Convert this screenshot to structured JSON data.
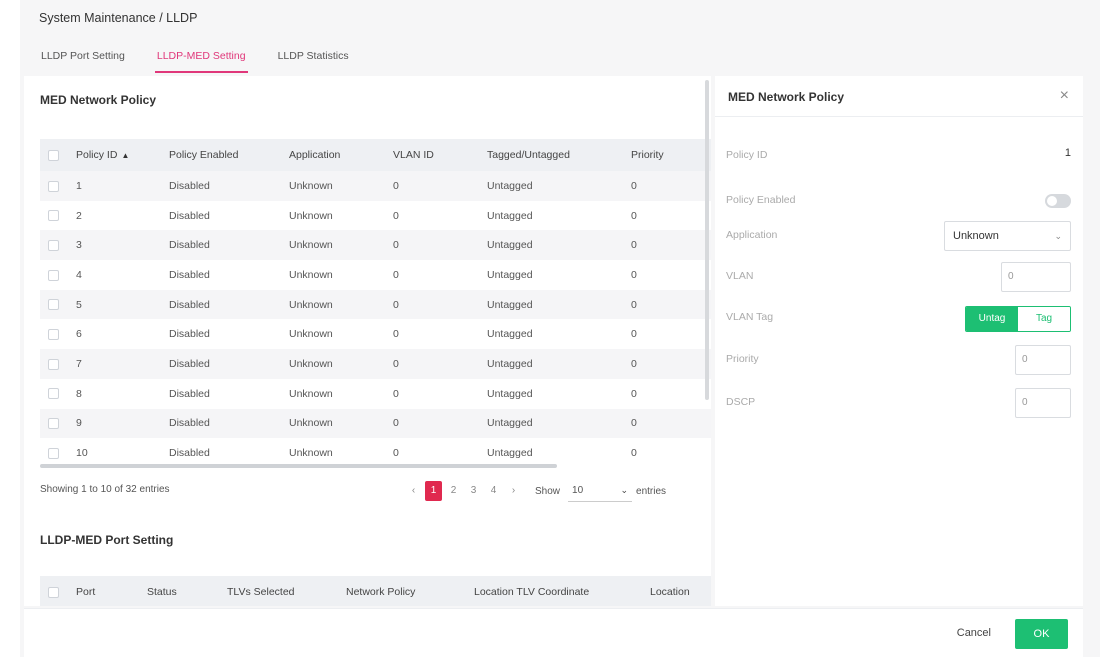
{
  "breadcrumb": "System Maintenance / LLDP",
  "tabs": [
    {
      "label": "LLDP Port Setting"
    },
    {
      "label": "LLDP-MED Setting"
    },
    {
      "label": "LLDP Statistics"
    }
  ],
  "policy_section": {
    "title": "MED Network Policy",
    "columns": [
      "Policy ID",
      "Policy Enabled",
      "Application",
      "VLAN ID",
      "Tagged/Untagged",
      "Priority"
    ],
    "rows": [
      [
        "1",
        "Disabled",
        "Unknown",
        "0",
        "Untagged",
        "0"
      ],
      [
        "2",
        "Disabled",
        "Unknown",
        "0",
        "Untagged",
        "0"
      ],
      [
        "3",
        "Disabled",
        "Unknown",
        "0",
        "Untagged",
        "0"
      ],
      [
        "4",
        "Disabled",
        "Unknown",
        "0",
        "Untagged",
        "0"
      ],
      [
        "5",
        "Disabled",
        "Unknown",
        "0",
        "Untagged",
        "0"
      ],
      [
        "6",
        "Disabled",
        "Unknown",
        "0",
        "Untagged",
        "0"
      ],
      [
        "7",
        "Disabled",
        "Unknown",
        "0",
        "Untagged",
        "0"
      ],
      [
        "8",
        "Disabled",
        "Unknown",
        "0",
        "Untagged",
        "0"
      ],
      [
        "9",
        "Disabled",
        "Unknown",
        "0",
        "Untagged",
        "0"
      ],
      [
        "10",
        "Disabled",
        "Unknown",
        "0",
        "Untagged",
        "0"
      ]
    ],
    "showing_text": "Showing 1 to 10 of 32 entries",
    "pages": [
      "1",
      "2",
      "3",
      "4"
    ],
    "prev": "‹",
    "next": "›",
    "show_label": "Show",
    "entries_value": "10",
    "entries_label": "entries"
  },
  "port_section": {
    "title": "LLDP-MED Port Setting",
    "columns": [
      "Port",
      "Status",
      "TLVs Selected",
      "Network Policy",
      "Location TLV Coordinate",
      "Location"
    ]
  },
  "side_panel": {
    "title": "MED Network Policy",
    "close": "×",
    "fields": {
      "policy_id": {
        "label": "Policy ID",
        "value": "1"
      },
      "policy_enabled": {
        "label": "Policy Enabled"
      },
      "application": {
        "label": "Application",
        "value": "Unknown"
      },
      "vlan": {
        "label": "VLAN",
        "value": "0"
      },
      "vlan_tag": {
        "label": "VLAN Tag",
        "untag": "Untag",
        "tag": "Tag"
      },
      "priority": {
        "label": "Priority",
        "value": "0"
      },
      "dscp": {
        "label": "DSCP",
        "value": "0"
      }
    }
  },
  "footer": {
    "cancel": "Cancel",
    "ok": "OK"
  },
  "colors": {
    "accent_pink": "#e0377a",
    "page_active": "#e0294f",
    "green": "#1dbf73"
  },
  "icons": {
    "close": "close-icon",
    "sort": "sort-asc-icon",
    "chevron": "chevron-down-icon"
  }
}
